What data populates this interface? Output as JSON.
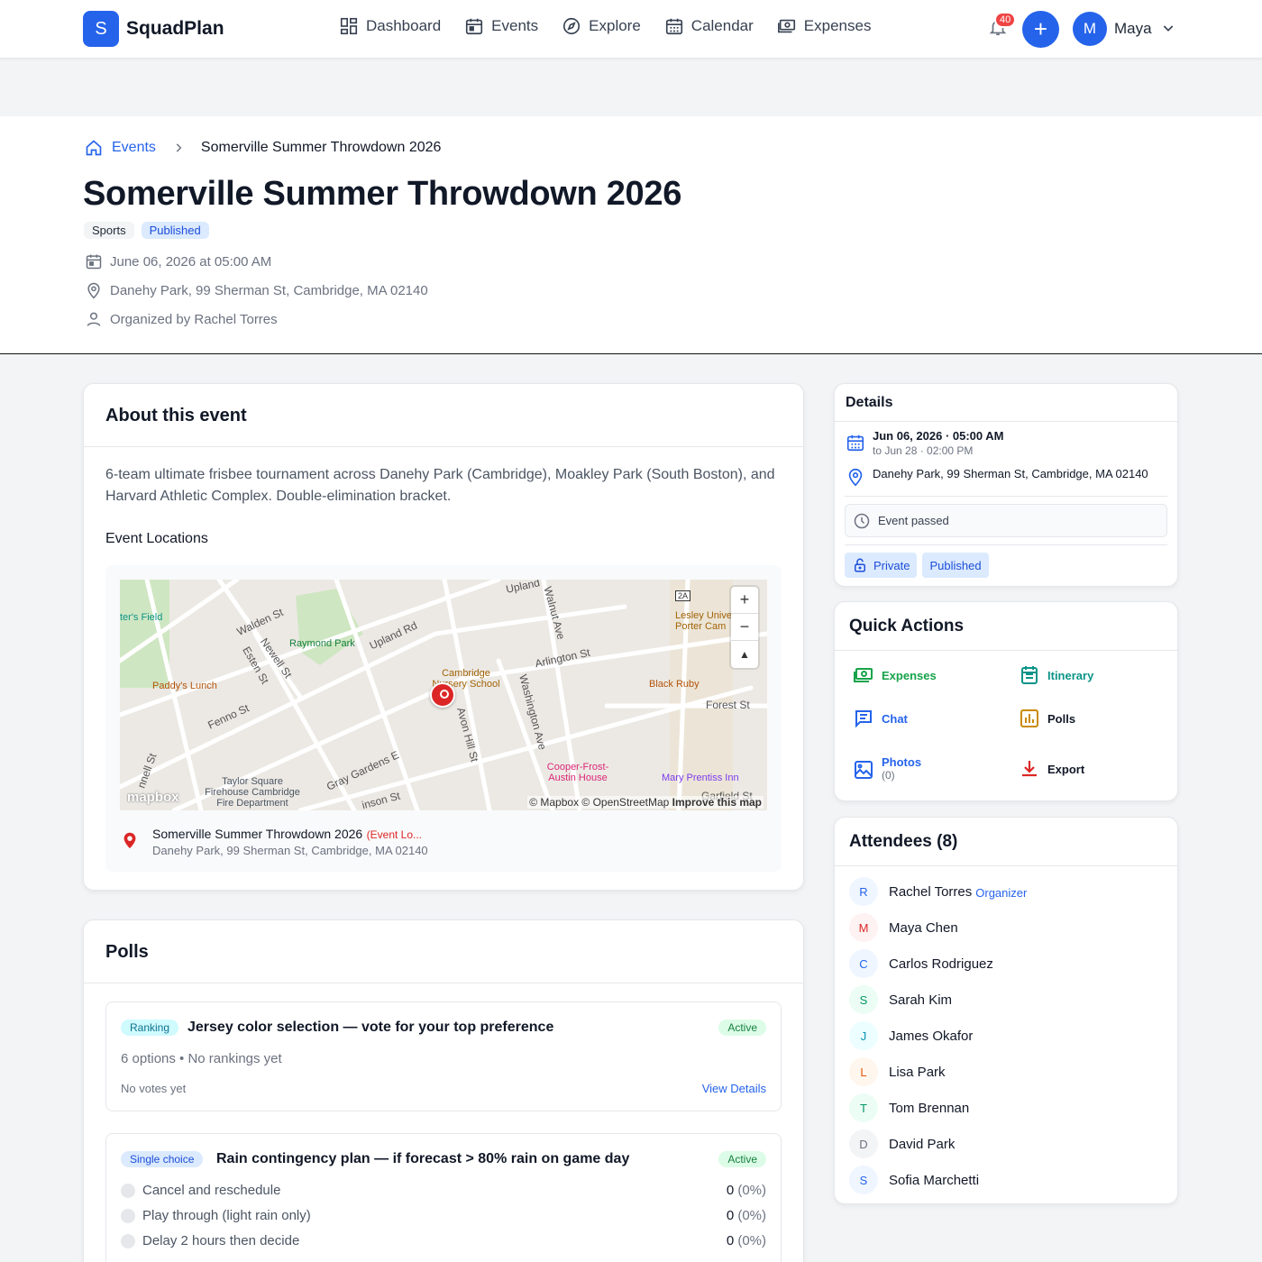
{
  "nav": {
    "logo_letter": "S",
    "logo_text": "SquadPlan",
    "links": [
      {
        "label": "Dashboard",
        "icon": "dashboard-icon"
      },
      {
        "label": "Events",
        "icon": "calendar-icon"
      },
      {
        "label": "Explore",
        "icon": "compass-icon"
      },
      {
        "label": "Calendar",
        "icon": "calendar-grid-icon"
      },
      {
        "label": "Expenses",
        "icon": "money-icon"
      }
    ],
    "notification_count": "40",
    "create_label": "+",
    "user_initial": "M",
    "user_name": "Maya"
  },
  "breadcrumb": {
    "home": "Events",
    "current": "Somerville Summer Throwdown 2026"
  },
  "event": {
    "title": "Somerville Summer Throwdown 2026",
    "tags": [
      "Sports",
      "Published"
    ],
    "date": "June 06, 2026 at 05:00 AM",
    "location": "Danehy Park, 99 Sherman St, Cambridge, MA 02140",
    "organizer": "Organized by Rachel Torres"
  },
  "about": {
    "title": "About this event",
    "description": "6-team ultimate frisbee tournament across Danehy Park (Cambridge), Moakley Park (South Boston), and Harvard Athletic Complex. Double-elimination bracket.",
    "locations_title": "Event Locations",
    "map": {
      "labels": [
        "Walden St",
        "Newell St",
        "Upland Rd",
        "Arlington St",
        "Walnut Ave",
        "Washington Ave",
        "Avon Hill St",
        "Fenno St",
        "Gray Gardens E",
        "Forest St",
        "Esten St",
        "Upland",
        "Garfield St",
        "nnell St",
        "inson St"
      ],
      "pois": [
        "Raymond Park",
        "Cambridge Nursery School",
        "Paddy's Lunch",
        "Black Ruby",
        "Lesley Unive Porter Cam",
        "Taylor Square Firehouse Cambridge Fire Department",
        "Cooper-Frost-Austin House",
        "Mary Prentiss Inn",
        "ter's Field"
      ],
      "attribution": "© Mapbox © OpenStreetMap",
      "improve": "Improve this map",
      "logo": "mapbox",
      "highway": "2A",
      "zoom_in": "+",
      "zoom_out": "−",
      "compass": "▲"
    },
    "location_item": {
      "name": "Somerville Summer Throwdown 2026",
      "tag": "(Event Lo...",
      "address": "Danehy Park, 99 Sherman St, Cambridge, MA 02140"
    }
  },
  "polls": {
    "title": "Polls",
    "items": [
      {
        "type": "Ranking",
        "question": "Jersey color selection — vote for your top preference",
        "status": "Active",
        "meta": "6 options • No rankings yet",
        "votes": "No votes yet",
        "link": "View Details"
      },
      {
        "type": "Single choice",
        "question": "Rain contingency plan — if forecast > 80% rain on game day",
        "status": "Active",
        "options": [
          {
            "label": "Cancel and reschedule",
            "count": "0",
            "pct": "(0%)"
          },
          {
            "label": "Play through (light rain only)",
            "count": "0",
            "pct": "(0%)"
          },
          {
            "label": "Delay 2 hours then decide",
            "count": "0",
            "pct": "(0%)"
          }
        ]
      }
    ]
  },
  "details": {
    "title": "Details",
    "start": "Jun 06, 2026 · 05:00 AM",
    "end": "to Jun 28 · 02:00 PM",
    "location": "Danehy Park, 99 Sherman St, Cambridge, MA 02140",
    "status": "Event passed",
    "privacy": "Private",
    "published": "Published"
  },
  "quick_actions": {
    "title": "Quick Actions",
    "items": [
      {
        "label": "Expenses",
        "icon": "money-icon",
        "color": "#16a34a"
      },
      {
        "label": "Itinerary",
        "icon": "itinerary-icon",
        "color": "#0d9488"
      },
      {
        "label": "Chat",
        "icon": "chat-icon",
        "color": "#2563eb"
      },
      {
        "label": "Polls",
        "icon": "poll-chart-icon",
        "color": "#ca8a04"
      },
      {
        "label": "Photos",
        "sub": "(0)",
        "icon": "image-icon",
        "color": "#2563eb"
      },
      {
        "label": "Export",
        "icon": "download-icon",
        "color": "#dc2626"
      }
    ]
  },
  "attendees": {
    "title": "Attendees (8)",
    "items": [
      {
        "initial": "R",
        "name": "Rachel Torres",
        "role": "Organizer",
        "bg": "#eff6ff",
        "fg": "#2563eb"
      },
      {
        "initial": "M",
        "name": "Maya Chen",
        "bg": "#fef2f2",
        "fg": "#dc2626"
      },
      {
        "initial": "C",
        "name": "Carlos Rodriguez",
        "bg": "#eff6ff",
        "fg": "#2563eb"
      },
      {
        "initial": "S",
        "name": "Sarah Kim",
        "bg": "#ecfdf5",
        "fg": "#059669"
      },
      {
        "initial": "J",
        "name": "James Okafor",
        "bg": "#ecfeff",
        "fg": "#0891b2"
      },
      {
        "initial": "L",
        "name": "Lisa Park",
        "bg": "#fff7ed",
        "fg": "#ea580c"
      },
      {
        "initial": "T",
        "name": "Tom Brennan",
        "bg": "#ecfdf5",
        "fg": "#059669"
      },
      {
        "initial": "D",
        "name": "David Park",
        "bg": "#f3f4f6",
        "fg": "#6b7280"
      },
      {
        "initial": "S",
        "name": "Sofia Marchetti",
        "bg": "#eff6ff",
        "fg": "#2563eb"
      }
    ]
  }
}
